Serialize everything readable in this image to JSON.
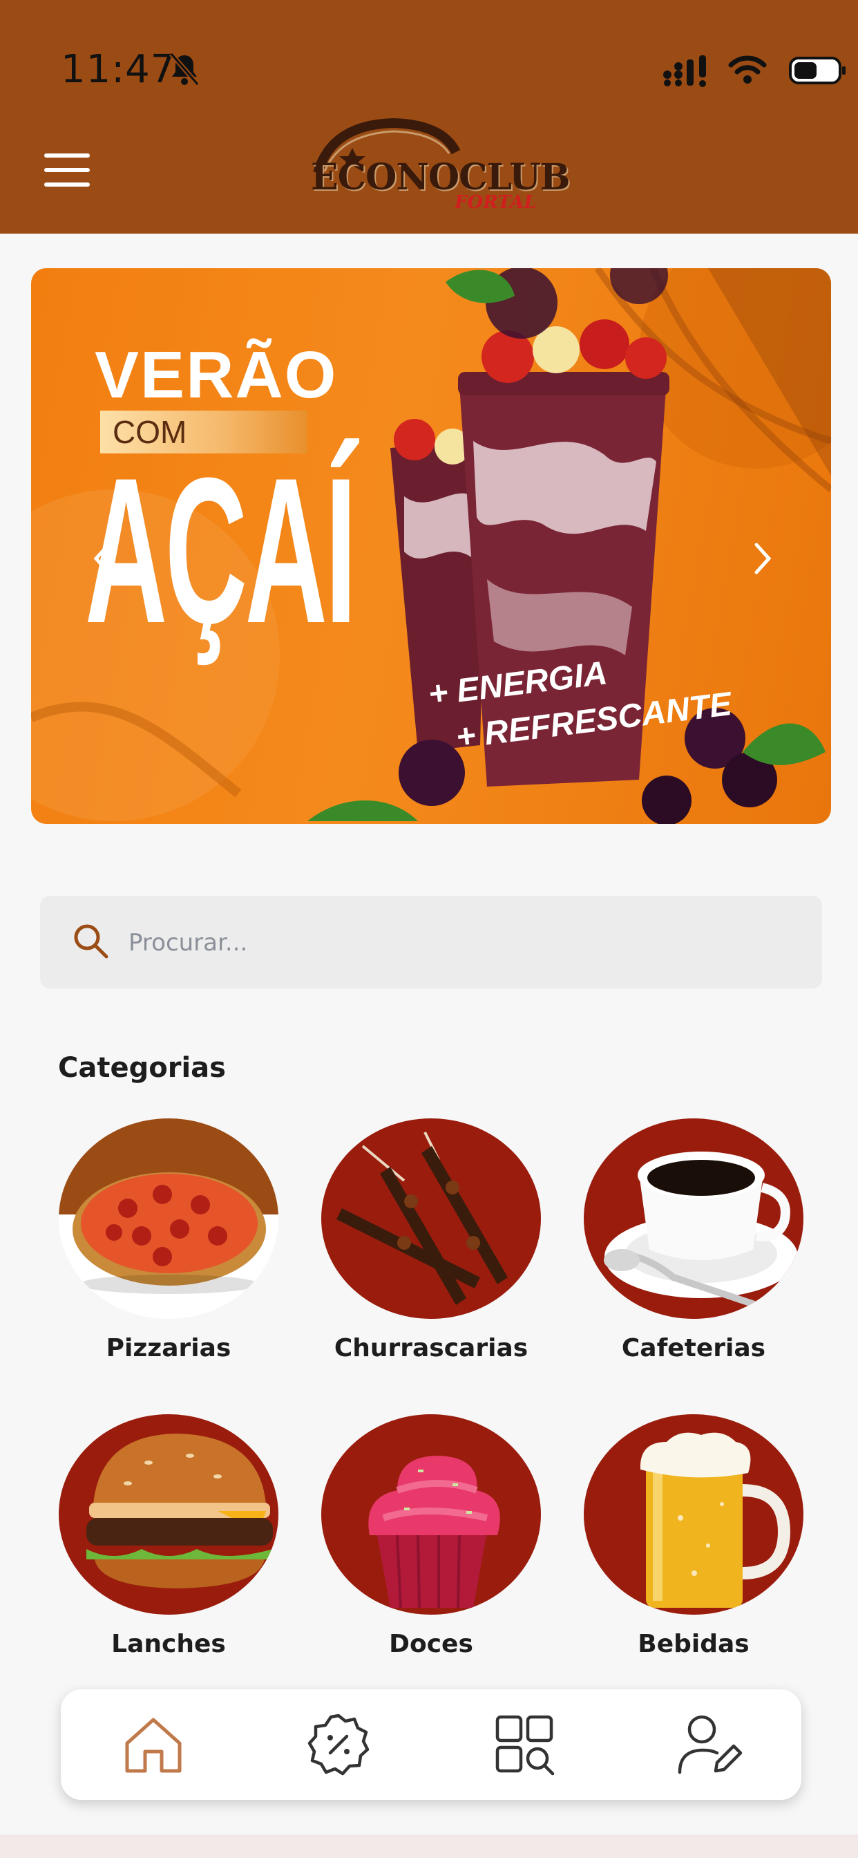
{
  "status_bar": {
    "time": "11:47"
  },
  "header": {
    "logo_text": "ECONOCLUB",
    "logo_subtext": "FORTAL"
  },
  "banner": {
    "headline_1": "VERÃO",
    "headline_2": "COM",
    "headline_3": "AÇAÍ",
    "tagline_1": "+ ENERGIA",
    "tagline_2": "+ REFRESCANTE",
    "colors": {
      "background": "#f27e10",
      "acai": "#6b1f2e"
    }
  },
  "search": {
    "placeholder": "Procurar..."
  },
  "categories": {
    "title": "Categorias",
    "items": [
      {
        "label": "Pizzarias",
        "icon": "pizza-image"
      },
      {
        "label": "Churrascarias",
        "icon": "skewers-image"
      },
      {
        "label": "Cafeterias",
        "icon": "coffee-cup-image"
      },
      {
        "label": "Lanches",
        "icon": "burger-image"
      },
      {
        "label": "Doces",
        "icon": "cupcake-image"
      },
      {
        "label": "Bebidas",
        "icon": "beer-mug-image"
      }
    ]
  },
  "bottom_nav": {
    "items": [
      {
        "icon": "home-icon",
        "active": true
      },
      {
        "icon": "discount-badge-icon",
        "active": false
      },
      {
        "icon": "category-search-icon",
        "active": false
      },
      {
        "icon": "user-edit-icon",
        "active": false
      }
    ]
  },
  "theme": {
    "primary": "#9b4c15",
    "accent": "#9a1c0d"
  }
}
